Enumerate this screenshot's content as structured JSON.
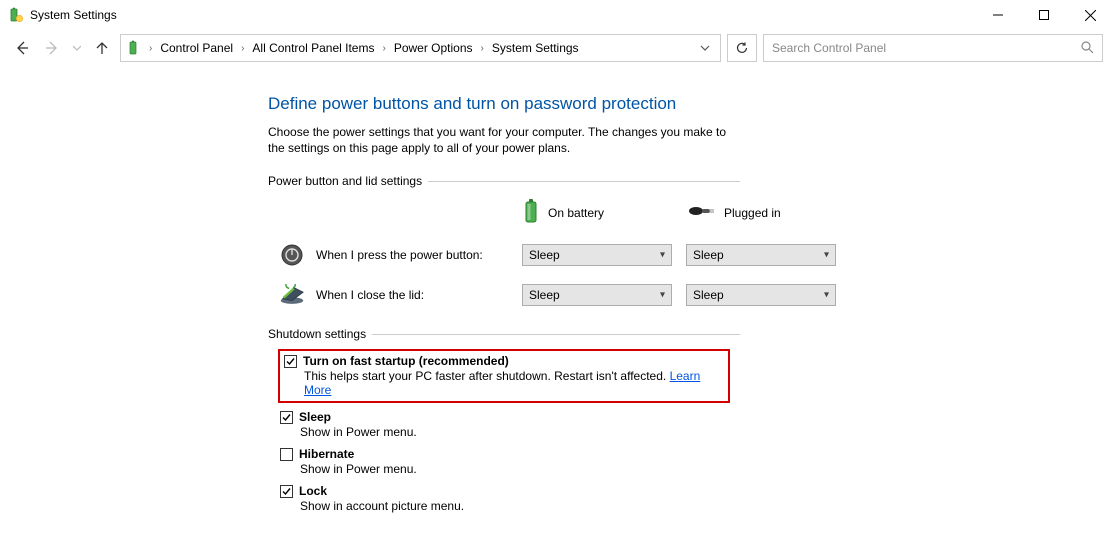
{
  "window": {
    "title": "System Settings"
  },
  "breadcrumbs": [
    "Control Panel",
    "All Control Panel Items",
    "Power Options",
    "System Settings"
  ],
  "search": {
    "placeholder": "Search Control Panel"
  },
  "page": {
    "heading": "Define power buttons and turn on password protection",
    "description": "Choose the power settings that you want for your computer. The changes you make to the settings on this page apply to all of your power plans."
  },
  "section_power": {
    "title": "Power button and lid settings",
    "col_battery": "On battery",
    "col_plugged": "Plugged in",
    "row_power_button": "When I press the power button:",
    "row_lid": "When I close the lid:",
    "val_power_battery": "Sleep",
    "val_power_plugged": "Sleep",
    "val_lid_battery": "Sleep",
    "val_lid_plugged": "Sleep"
  },
  "section_shutdown": {
    "title": "Shutdown settings",
    "items": [
      {
        "label": "Turn on fast startup (recommended)",
        "desc": "This helps start your PC faster after shutdown. Restart isn't affected. ",
        "link": "Learn More",
        "checked": true,
        "highlighted": true
      },
      {
        "label": "Sleep",
        "desc": "Show in Power menu.",
        "checked": true
      },
      {
        "label": "Hibernate",
        "desc": "Show in Power menu.",
        "checked": false
      },
      {
        "label": "Lock",
        "desc": "Show in account picture menu.",
        "checked": true
      }
    ]
  }
}
